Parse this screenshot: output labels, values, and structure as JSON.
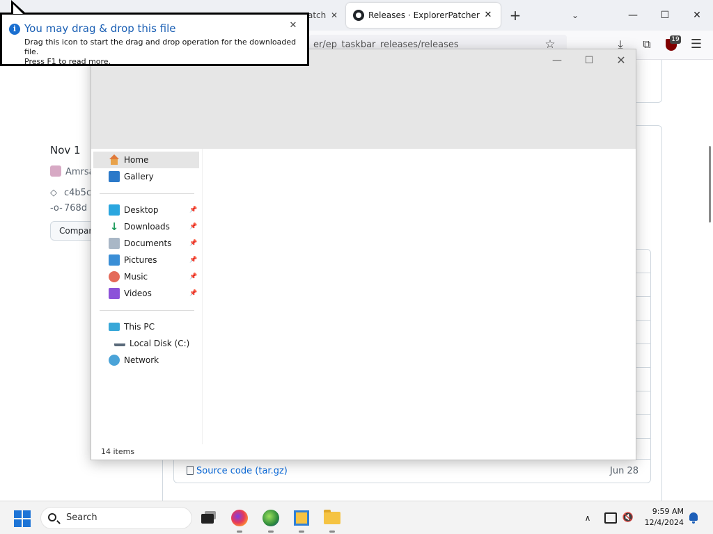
{
  "browser": {
    "partial_tab_title": "atch",
    "active_tab_title": "Releases · ExplorerPatcher/ep_t",
    "url_text": "er/ep_taskbar_releases/releases",
    "ublock_badge": "19",
    "close_glyph": "✕",
    "new_tab_glyph": "+",
    "tab_list_glyph": "⌄",
    "minimize_glyph": "—",
    "maximize_glyph": "☐",
    "star_glyph": "☆",
    "download_glyph": "⤓",
    "extensions_glyph": "⧉",
    "menu_glyph": "☰"
  },
  "page": {
    "release_date": "Nov 1",
    "author": "Amrsa",
    "tag": "c4b5c",
    "commit": "768d",
    "compare_label": "Compare",
    "source_code_label": "Source code",
    "source_code_type": "(tar.gz)",
    "source_code_date": "Jun 28",
    "tag_glyph": "◇",
    "commit_glyph": "-o-"
  },
  "tooltip": {
    "title": "You may drag & drop this file",
    "line1": "Drag this icon to start the drag and drop operation for the downloaded file.",
    "line2": "Press F1 to read more.",
    "info_glyph": "i",
    "close_glyph": "✕"
  },
  "explorer": {
    "status": "14 items",
    "minimize_glyph": "—",
    "maximize_glyph": "☐",
    "close_glyph": "✕",
    "pin_glyph": "📌",
    "nav": {
      "home": "Home",
      "gallery": "Gallery",
      "desktop": "Desktop",
      "downloads": "Downloads",
      "documents": "Documents",
      "pictures": "Pictures",
      "music": "Music",
      "videos": "Videos",
      "this_pc": "This PC",
      "local_disk": "Local Disk (C:)",
      "network": "Network"
    }
  },
  "taskbar": {
    "search_placeholder": "Search",
    "time": "9:59 AM",
    "date": "12/4/2024",
    "chevron_glyph": "∧",
    "volume_glyph": "🔇"
  },
  "colors": {
    "accent": "#0969da",
    "tooltip_title": "#1a5fb4",
    "ublock": "#800000"
  }
}
